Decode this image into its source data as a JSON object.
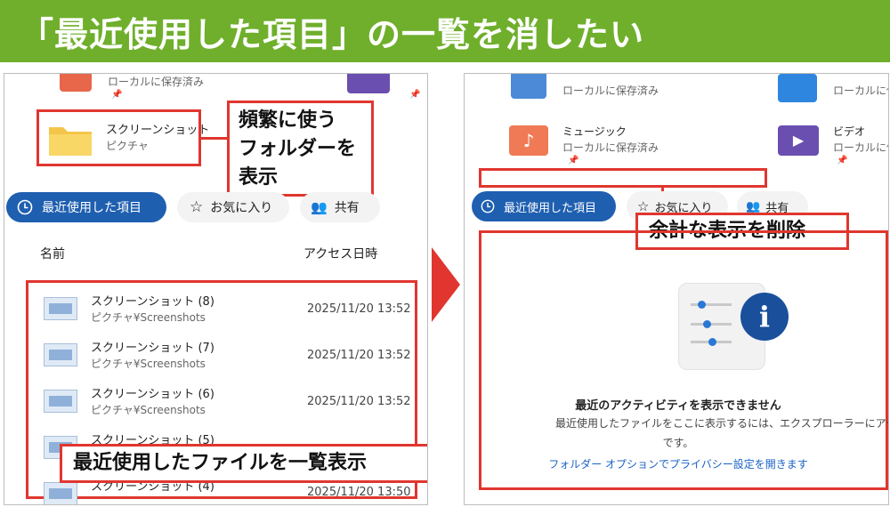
{
  "banner": {
    "title": "「最近使用した項目」の一覧を消したい"
  },
  "left": {
    "top_item": {
      "sub": "ローカルに保存済み"
    },
    "folder": {
      "name": "スクリーンショット",
      "sub": "ピクチャ"
    },
    "callout_folders": {
      "lines": [
        "頻繁に使う",
        "フォルダーを",
        "表示"
      ]
    },
    "tabs": [
      {
        "label": "最近使用した項目"
      },
      {
        "label": "お気に入り"
      },
      {
        "label": "共有"
      }
    ],
    "columns": {
      "name": "名前",
      "access": "アクセス日時"
    },
    "rows": [
      {
        "name": "スクリーンショット (8)",
        "path": "ピクチャ¥Screenshots",
        "date": "2025/11/20 13:52"
      },
      {
        "name": "スクリーンショット (7)",
        "path": "ピクチャ¥Screenshots",
        "date": "2025/11/20 13:52"
      },
      {
        "name": "スクリーンショット (6)",
        "path": "ピクチャ¥Screenshots",
        "date": "2025/11/20 13:52"
      },
      {
        "name": "スクリーンショット (5)",
        "path": "",
        "date": ""
      },
      {
        "name": "スクリーンショット (4)",
        "path": "",
        "date": "2025/11/20 13:50"
      }
    ],
    "callout_files": {
      "text": "最近使用したファイルを一覧表示"
    }
  },
  "right": {
    "items": [
      {
        "name": "",
        "sub": "ローカルに保存済み"
      },
      {
        "name": "",
        "sub": "ローカルに保"
      },
      {
        "name": "ミュージック",
        "sub": "ローカルに保存済み"
      },
      {
        "name": "ビデオ",
        "sub": "ローカルに保"
      }
    ],
    "tabs": [
      {
        "label": "最近使用した項目"
      },
      {
        "label": "お気に入り"
      },
      {
        "label": "共有"
      }
    ],
    "callout_removed": {
      "text": "余計な表示を削除"
    },
    "empty": {
      "title": "最近のアクティビティを表示できません",
      "body1": "最近使用したファイルをここに表示するには、エクスプローラーにアクセス許可が",
      "body2": "です。",
      "link": "フォルダー オプションでプライバシー設定を開きます"
    }
  },
  "colors": {
    "banner": "#6faf2c",
    "accent": "#1f5fb0",
    "callout": "#e0362f"
  }
}
